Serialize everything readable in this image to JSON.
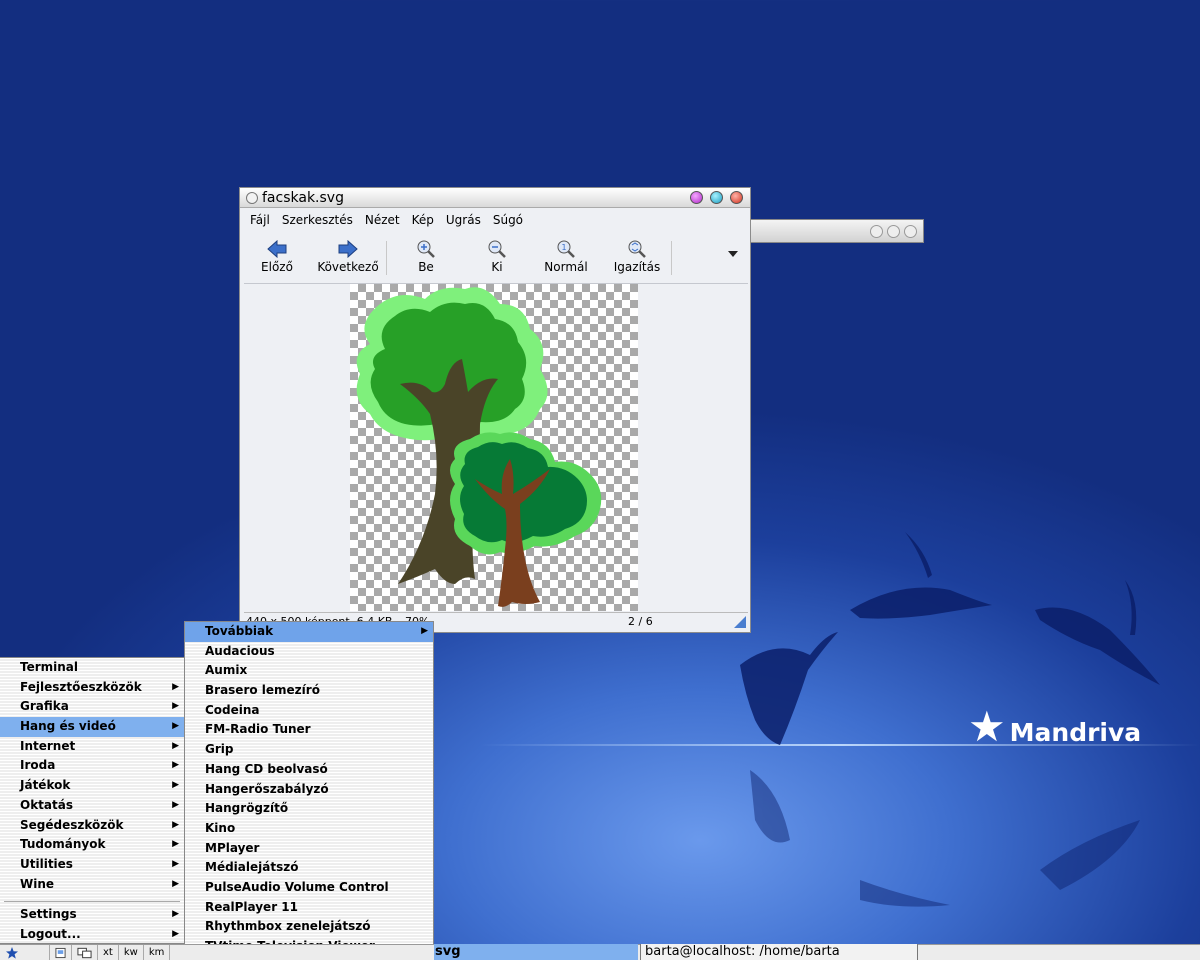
{
  "desktop": {
    "brand": "Mandriva"
  },
  "window": {
    "title": "facskak.svg",
    "menu": [
      "Fájl",
      "Szerkesztés",
      "Nézet",
      "Kép",
      "Ugrás",
      "Súgó"
    ],
    "toolbar": {
      "prev": "Előző",
      "next": "Következő",
      "zoom_in": "Be",
      "zoom_out": "Ki",
      "normal": "Normál",
      "fit": "Igazítás"
    },
    "status_left": "440 x 500 képpont, 6,4 KB – 70%",
    "status_right": "2 / 6"
  },
  "mainmenu": {
    "items": [
      {
        "label": "Terminal",
        "arrow": ""
      },
      {
        "label": "Fejlesztőeszközök",
        "arrow": "▶"
      },
      {
        "label": "Grafika",
        "arrow": "▶"
      },
      {
        "label": "Hang és videó",
        "arrow": "▶"
      },
      {
        "label": "Internet",
        "arrow": "▶"
      },
      {
        "label": "Iroda",
        "arrow": "▶"
      },
      {
        "label": "Játékok",
        "arrow": "▶"
      },
      {
        "label": "Oktatás",
        "arrow": "▶"
      },
      {
        "label": "Segédeszközök",
        "arrow": "▶"
      },
      {
        "label": "Tudományok",
        "arrow": "▶"
      },
      {
        "label": "Utilities",
        "arrow": "▶"
      },
      {
        "label": "Wine",
        "arrow": "▶"
      }
    ],
    "settings": "Settings",
    "logout": "Logout..."
  },
  "submenu": {
    "items": [
      "Továbbiak",
      "Audacious",
      "Aumix",
      "Brasero lemezíró",
      "Codeina",
      "FM-Radio Tuner",
      "Grip",
      "Hang CD beolvasó",
      "Hangerőszabályzó",
      "Hangrögzítő",
      "Kino",
      "MPlayer",
      "Médialejátszó",
      "PulseAudio Volume Control",
      "RealPlayer 11",
      "Rhythmbox zenelejátszó",
      "TVtime Television Viewer"
    ]
  },
  "taskbar": {
    "buttons": [
      "xt",
      "kw",
      "km"
    ],
    "active_task": "svg",
    "terminal_task": "barta@localhost: /home/barta"
  }
}
